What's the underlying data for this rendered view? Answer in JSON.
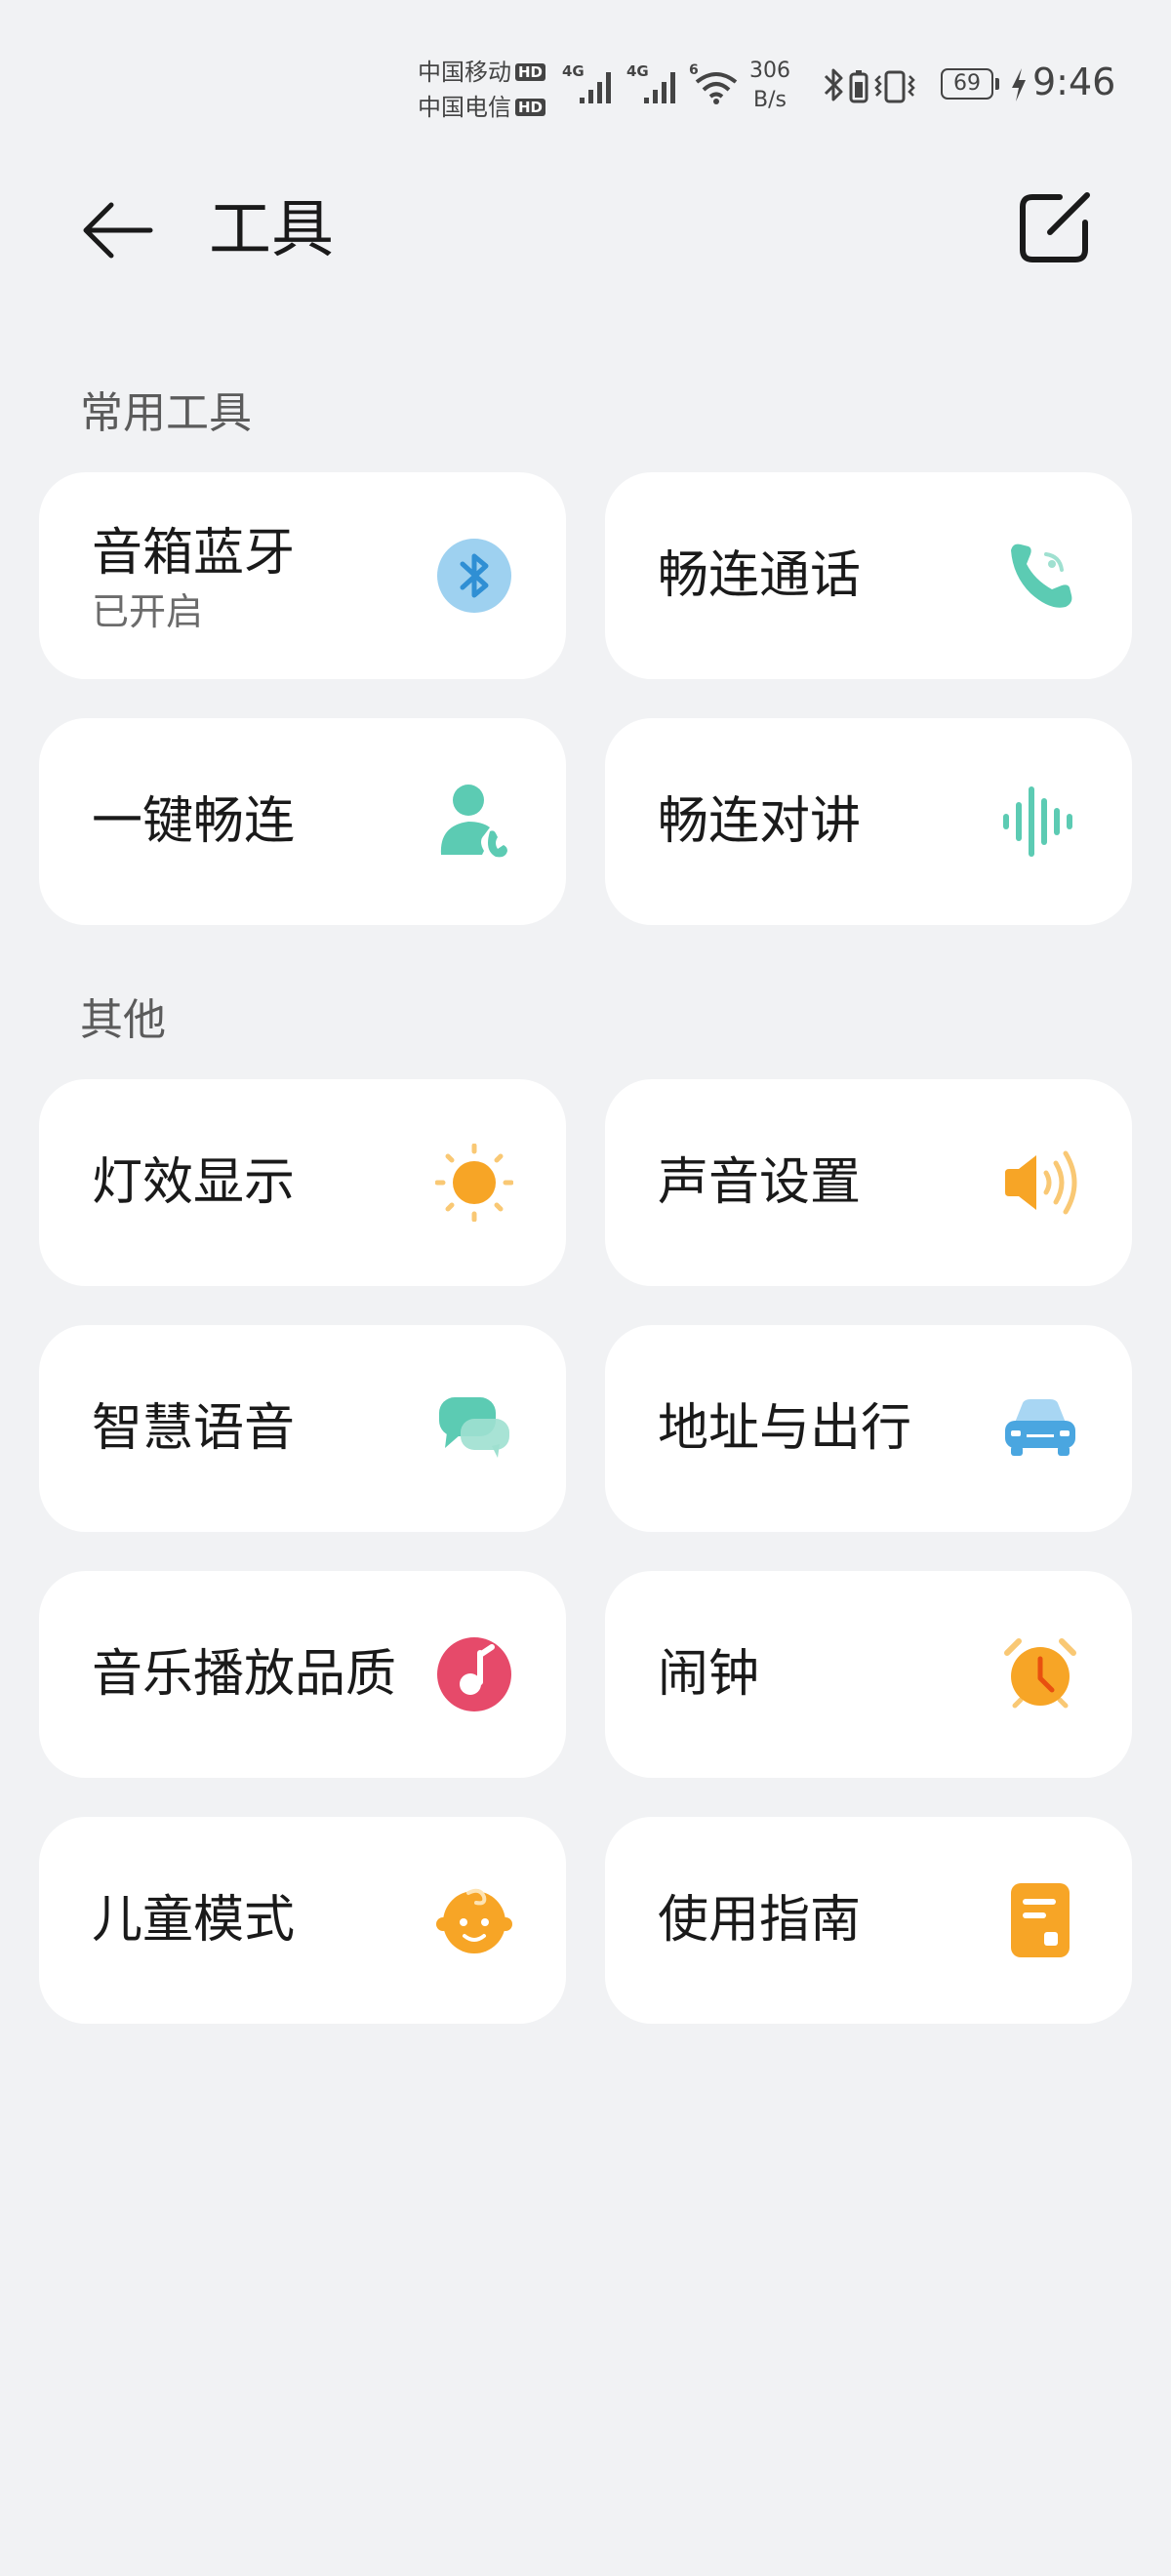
{
  "status_bar": {
    "carrier_1": "中国移动",
    "carrier_2": "中国电信",
    "hd_label": "HD",
    "net_type": "4G",
    "wifi_type": "6",
    "speed_value": "306",
    "speed_unit": "B/s",
    "battery_level": "69",
    "time": "9:46"
  },
  "header": {
    "title": "工具"
  },
  "sections": {
    "common": {
      "title": "常用工具",
      "items": [
        {
          "label": "音箱蓝牙",
          "sublabel": "已开启",
          "icon": "bluetooth-icon"
        },
        {
          "label": "畅连通话",
          "icon": "phone-call-icon"
        },
        {
          "label": "一键畅连",
          "icon": "contact-call-icon"
        },
        {
          "label": "畅连对讲",
          "icon": "voice-wave-icon"
        }
      ]
    },
    "other": {
      "title": "其他",
      "items": [
        {
          "label": "灯效显示",
          "icon": "sun-icon"
        },
        {
          "label": "声音设置",
          "icon": "speaker-icon"
        },
        {
          "label": "智慧语音",
          "icon": "chat-bubble-icon"
        },
        {
          "label": "地址与出行",
          "icon": "car-icon"
        },
        {
          "label": "音乐播放品质",
          "icon": "music-note-icon"
        },
        {
          "label": "闹钟",
          "icon": "alarm-clock-icon"
        },
        {
          "label": "儿童模式",
          "icon": "baby-face-icon"
        },
        {
          "label": "使用指南",
          "icon": "guide-document-icon"
        }
      ]
    }
  },
  "colors": {
    "background": "#f1f2f4",
    "card": "#ffffff",
    "bluetooth_bg": "#9ed1f0",
    "bluetooth_fg": "#2f8fd4",
    "teal": "#5ccbb3",
    "orange": "#f7a526",
    "red_pink": "#e64a6a",
    "blue_car": "#4aa6e0"
  }
}
